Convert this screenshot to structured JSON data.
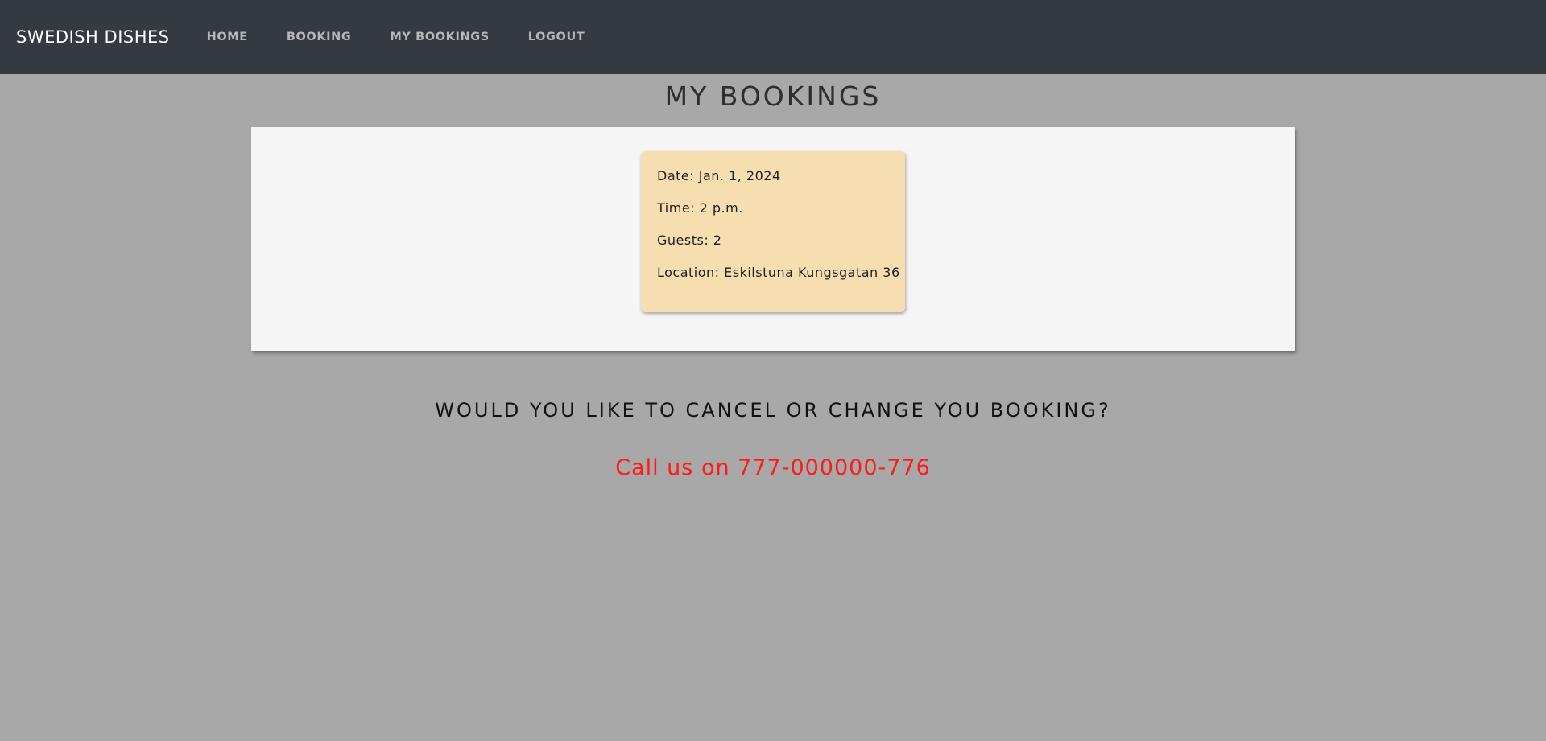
{
  "nav": {
    "brand": "SWEDISH DISHES",
    "items": [
      {
        "label": "HOME"
      },
      {
        "label": "BOOKING"
      },
      {
        "label": "MY BOOKINGS"
      },
      {
        "label": "LOGOUT"
      }
    ]
  },
  "main": {
    "title": "MY BOOKINGS",
    "booking": {
      "date": "Date: Jan. 1, 2024",
      "time": "Time: 2 p.m.",
      "guests": "Guests: 2",
      "location": "Location: Eskilstuna Kungsgatan 36"
    },
    "question": "WOULD YOU LIKE TO CANCEL OR CHANGE YOU BOOKING?",
    "call": "Call us on 777-000000-776"
  },
  "colors": {
    "navbar": "#343a40",
    "background": "#a8a8a8",
    "panel": "#f5f5f5",
    "card": "#f6deb1",
    "call_text": "#ff1a1a"
  }
}
